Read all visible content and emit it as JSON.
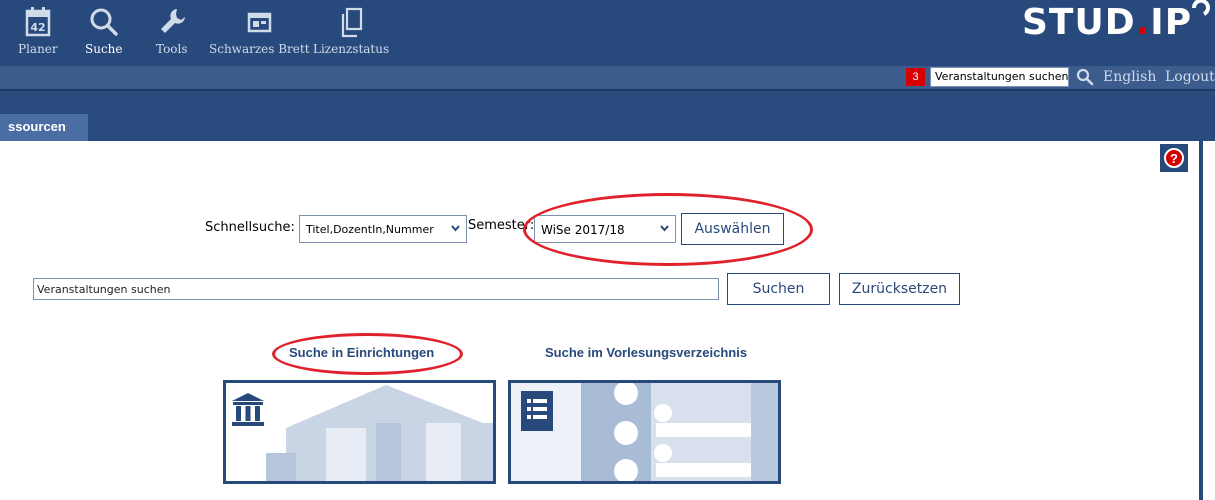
{
  "header": {
    "nav": [
      {
        "label": "Planer",
        "icon": "calendar-icon"
      },
      {
        "label": "Suche",
        "icon": "search-icon"
      },
      {
        "label": "Tools",
        "icon": "wrench-icon"
      },
      {
        "label": "Schwarzes Brett",
        "icon": "bulletin-board-icon"
      },
      {
        "label": "Lizenzstatus",
        "icon": "document-copy-icon"
      }
    ],
    "calendar_day": "42",
    "logo_text_before_dot": "STUD",
    "logo_dot": ".",
    "logo_text_after_dot": "IP",
    "notification_count": "3",
    "quicksearch_value": "Veranstaltungen suchen",
    "language": "English",
    "logout": "Logout"
  },
  "tabs": {
    "active_tab": "ssourcen"
  },
  "help": {
    "symbol": "?"
  },
  "search": {
    "quick_label": "Schnellsuche:",
    "quick_select_value": "Titel,DozentIn,Nummer",
    "semester_label": "Semester:",
    "semester_value": "WiSe 2017/18",
    "select_button": "Auswählen",
    "search_field_value": "Veranstaltungen suchen",
    "search_button": "Suchen",
    "reset_button": "Zurücksetzen"
  },
  "links": {
    "institutions": "Suche in Einrichtungen",
    "catalog": "Suche im Vorlesungsverzeichnis"
  },
  "colors": {
    "brand_blue": "#28497c",
    "highlight_red": "#e0212b",
    "notification_red": "#d60000"
  }
}
